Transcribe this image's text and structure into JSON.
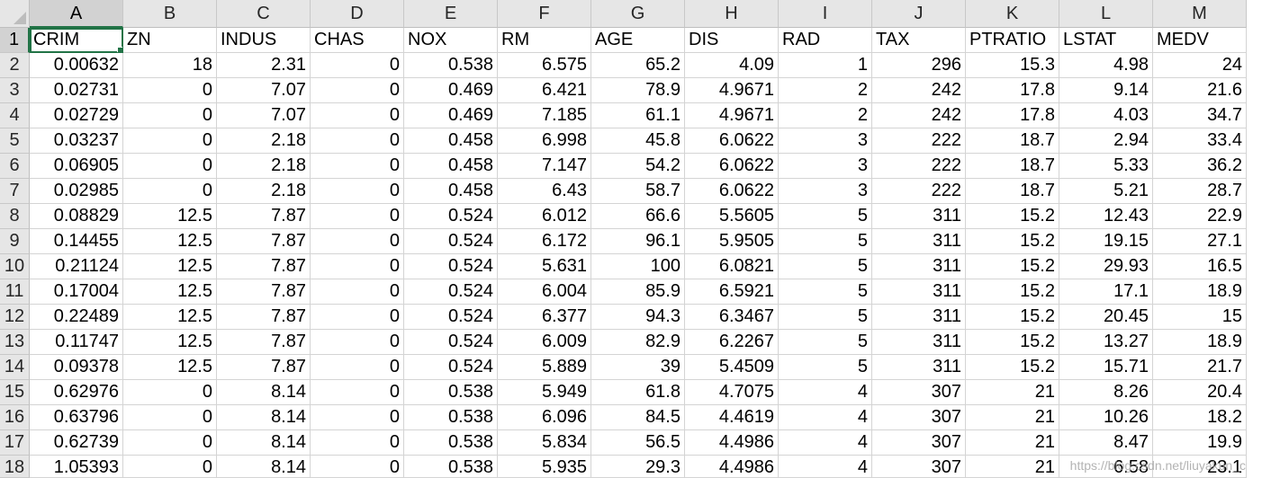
{
  "columns": [
    "A",
    "B",
    "C",
    "D",
    "E",
    "F",
    "G",
    "H",
    "I",
    "J",
    "K",
    "L",
    "M"
  ],
  "row_numbers": [
    "1",
    "2",
    "3",
    "4",
    "5",
    "6",
    "7",
    "8",
    "9",
    "10",
    "11",
    "12",
    "13",
    "14",
    "15",
    "16",
    "17",
    "18"
  ],
  "selected_cell": "A1",
  "colors": {
    "accent": "#217346",
    "header_bg": "#e6e6e6",
    "gridline": "#d4d4d4"
  },
  "table": {
    "headers": [
      "CRIM",
      "ZN",
      "INDUS",
      "CHAS",
      "NOX",
      "RM",
      "AGE",
      "DIS",
      "RAD",
      "TAX",
      "PTRATIO",
      "LSTAT",
      "MEDV"
    ],
    "rows": [
      [
        "0.00632",
        "18",
        "2.31",
        "0",
        "0.538",
        "6.575",
        "65.2",
        "4.09",
        "1",
        "296",
        "15.3",
        "4.98",
        "24"
      ],
      [
        "0.02731",
        "0",
        "7.07",
        "0",
        "0.469",
        "6.421",
        "78.9",
        "4.9671",
        "2",
        "242",
        "17.8",
        "9.14",
        "21.6"
      ],
      [
        "0.02729",
        "0",
        "7.07",
        "0",
        "0.469",
        "7.185",
        "61.1",
        "4.9671",
        "2",
        "242",
        "17.8",
        "4.03",
        "34.7"
      ],
      [
        "0.03237",
        "0",
        "2.18",
        "0",
        "0.458",
        "6.998",
        "45.8",
        "6.0622",
        "3",
        "222",
        "18.7",
        "2.94",
        "33.4"
      ],
      [
        "0.06905",
        "0",
        "2.18",
        "0",
        "0.458",
        "7.147",
        "54.2",
        "6.0622",
        "3",
        "222",
        "18.7",
        "5.33",
        "36.2"
      ],
      [
        "0.02985",
        "0",
        "2.18",
        "0",
        "0.458",
        "6.43",
        "58.7",
        "6.0622",
        "3",
        "222",
        "18.7",
        "5.21",
        "28.7"
      ],
      [
        "0.08829",
        "12.5",
        "7.87",
        "0",
        "0.524",
        "6.012",
        "66.6",
        "5.5605",
        "5",
        "311",
        "15.2",
        "12.43",
        "22.9"
      ],
      [
        "0.14455",
        "12.5",
        "7.87",
        "0",
        "0.524",
        "6.172",
        "96.1",
        "5.9505",
        "5",
        "311",
        "15.2",
        "19.15",
        "27.1"
      ],
      [
        "0.21124",
        "12.5",
        "7.87",
        "0",
        "0.524",
        "5.631",
        "100",
        "6.0821",
        "5",
        "311",
        "15.2",
        "29.93",
        "16.5"
      ],
      [
        "0.17004",
        "12.5",
        "7.87",
        "0",
        "0.524",
        "6.004",
        "85.9",
        "6.5921",
        "5",
        "311",
        "15.2",
        "17.1",
        "18.9"
      ],
      [
        "0.22489",
        "12.5",
        "7.87",
        "0",
        "0.524",
        "6.377",
        "94.3",
        "6.3467",
        "5",
        "311",
        "15.2",
        "20.45",
        "15"
      ],
      [
        "0.11747",
        "12.5",
        "7.87",
        "0",
        "0.524",
        "6.009",
        "82.9",
        "6.2267",
        "5",
        "311",
        "15.2",
        "13.27",
        "18.9"
      ],
      [
        "0.09378",
        "12.5",
        "7.87",
        "0",
        "0.524",
        "5.889",
        "39",
        "5.4509",
        "5",
        "311",
        "15.2",
        "15.71",
        "21.7"
      ],
      [
        "0.62976",
        "0",
        "8.14",
        "0",
        "0.538",
        "5.949",
        "61.8",
        "4.7075",
        "4",
        "307",
        "21",
        "8.26",
        "20.4"
      ],
      [
        "0.63796",
        "0",
        "8.14",
        "0",
        "0.538",
        "6.096",
        "84.5",
        "4.4619",
        "4",
        "307",
        "21",
        "10.26",
        "18.2"
      ],
      [
        "0.62739",
        "0",
        "8.14",
        "0",
        "0.538",
        "5.834",
        "56.5",
        "4.4986",
        "4",
        "307",
        "21",
        "8.47",
        "19.9"
      ],
      [
        "1.05393",
        "0",
        "8.14",
        "0",
        "0.538",
        "5.935",
        "29.3",
        "4.4986",
        "4",
        "307",
        "21",
        "6.58",
        "23.1"
      ]
    ]
  },
  "watermark": "https://blog.csdn.net/liuyakun_c"
}
